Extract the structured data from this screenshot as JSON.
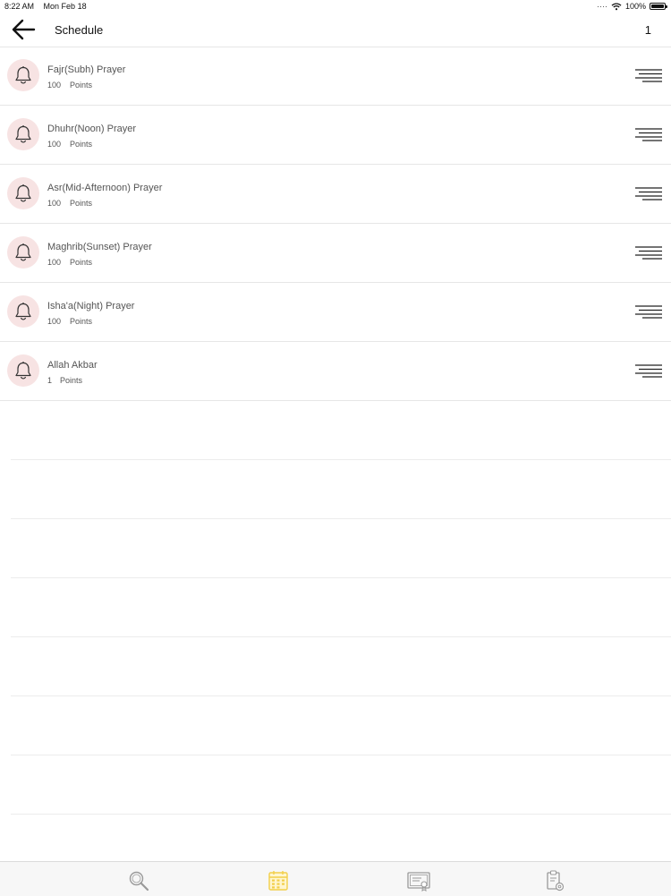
{
  "status_bar": {
    "time": "8:22 AM",
    "date": "Mon Feb 18",
    "battery": "100%"
  },
  "nav": {
    "title": "Schedule",
    "count": "1",
    "back_icon": "arrow-left-icon"
  },
  "items": [
    {
      "title": "Fajr(Subh) Prayer",
      "points_value": "100",
      "points_label": "Points"
    },
    {
      "title": "Dhuhr(Noon) Prayer",
      "points_value": "100",
      "points_label": "Points"
    },
    {
      "title": "Asr(Mid-Afternoon) Prayer",
      "points_value": "100",
      "points_label": "Points"
    },
    {
      "title": "Maghrib(Sunset) Prayer",
      "points_value": "100",
      "points_label": "Points"
    },
    {
      "title": "Isha'a(Night) Prayer",
      "points_value": "100",
      "points_label": "Points"
    },
    {
      "title": "Allah Akbar",
      "points_value": "1",
      "points_label": "Points"
    }
  ],
  "tabs": [
    {
      "icon": "search-icon",
      "active": false
    },
    {
      "icon": "calendar-icon",
      "active": true
    },
    {
      "icon": "certificate-icon",
      "active": false
    },
    {
      "icon": "clipboard-settings-icon",
      "active": false
    }
  ],
  "colors": {
    "bell_bg": "#f7e3e3",
    "active_tab": "#f2cf4a",
    "inactive_tab": "#9a9a9a",
    "divider": "#e6e6e6"
  }
}
